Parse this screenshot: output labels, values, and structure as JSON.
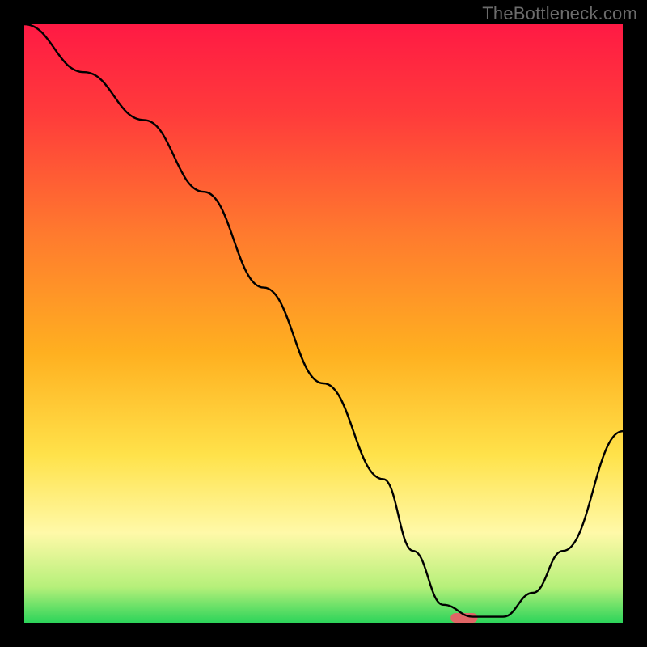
{
  "watermark": "TheBottleneck.com",
  "chart_data": {
    "type": "line",
    "title": "",
    "xlabel": "",
    "ylabel": "",
    "xlim": [
      0,
      100
    ],
    "ylim": [
      0,
      100
    ],
    "x": [
      0,
      10,
      20,
      30,
      40,
      50,
      60,
      65,
      70,
      75,
      80,
      85,
      90,
      100
    ],
    "values": [
      100,
      92,
      84,
      72,
      56,
      40,
      24,
      12,
      3,
      1,
      1,
      5,
      12,
      32
    ],
    "notes": "Values are estimated from the curve position against the vertical gradient (red≈100, green≈0). Curve starts at top-left, descends steeply to a minimum around x≈72-78, then rises toward the right edge.",
    "marker": {
      "x": 73.5,
      "width": 4.5,
      "color": "#e06666"
    },
    "gradient_stops": [
      {
        "offset": 0.0,
        "color": "#ff1a44"
      },
      {
        "offset": 0.15,
        "color": "#ff3b3b"
      },
      {
        "offset": 0.35,
        "color": "#ff7a2e"
      },
      {
        "offset": 0.55,
        "color": "#ffb020"
      },
      {
        "offset": 0.72,
        "color": "#ffe24a"
      },
      {
        "offset": 0.85,
        "color": "#fff9a8"
      },
      {
        "offset": 0.94,
        "color": "#b6f07a"
      },
      {
        "offset": 1.0,
        "color": "#2cd45a"
      }
    ]
  }
}
